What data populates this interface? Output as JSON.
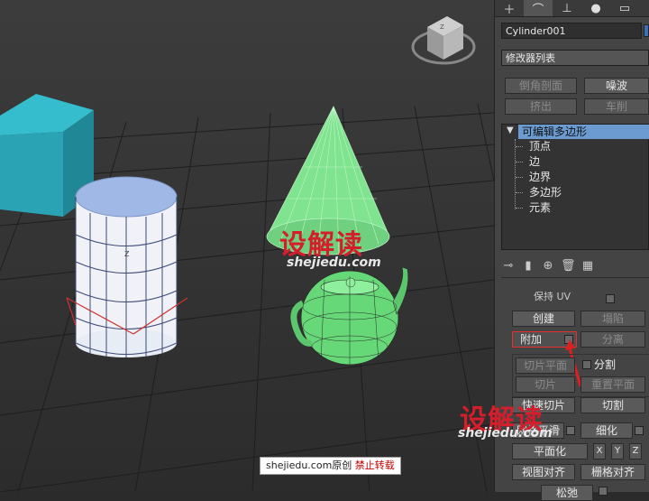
{
  "viewport": {
    "gizmo_axis_label": "Z",
    "cylinder_axis_label": "Z"
  },
  "panel": {
    "tabs": [
      "+",
      "modify-icon",
      "hierarchy-icon",
      "motion-icon",
      "display-icon"
    ],
    "object_name": "Cylinder001",
    "modifier_list_label": "修改器列表",
    "buttons_row1": [
      "倒角剖面",
      "噪波"
    ],
    "buttons_row2": [
      "挤出",
      "车削"
    ],
    "stack": {
      "root": "可编辑多边形",
      "items": [
        "顶点",
        "边",
        "边界",
        "多边形",
        "元素"
      ]
    },
    "section_cut_label": "保持 UV",
    "create_label": "创建",
    "collapse_label": "塌陷",
    "attach_label": "附加",
    "detach_label": "分离",
    "slice_plane_label": "切片平面",
    "split_label": "分割",
    "slice_label": "切片",
    "reset_plane_label": "重置平面",
    "quickslice_label": "快速切片",
    "cut_label": "切割",
    "meshsmooth_label": "网格平滑",
    "tessellate_label": "细化",
    "planarize_label": "平面化",
    "x_label": "X",
    "y_label": "Y",
    "z_label": "Z",
    "view_align_label": "视图对齐",
    "grid_align_label": "栅格对齐",
    "relax_label": "松弛"
  },
  "watermark": {
    "main": "设解读",
    "sub": "shejiedu.com",
    "footer_site": "shejiedu.com原创",
    "footer_red": "禁止转载"
  },
  "colors": {
    "accent_red": "#d41e2b",
    "stack_highlight": "#6b9bd1",
    "mesh_green": "#7fe38f",
    "box_cyan": "#2aa3b4",
    "cylinder_blue": "#9fb8e6"
  }
}
